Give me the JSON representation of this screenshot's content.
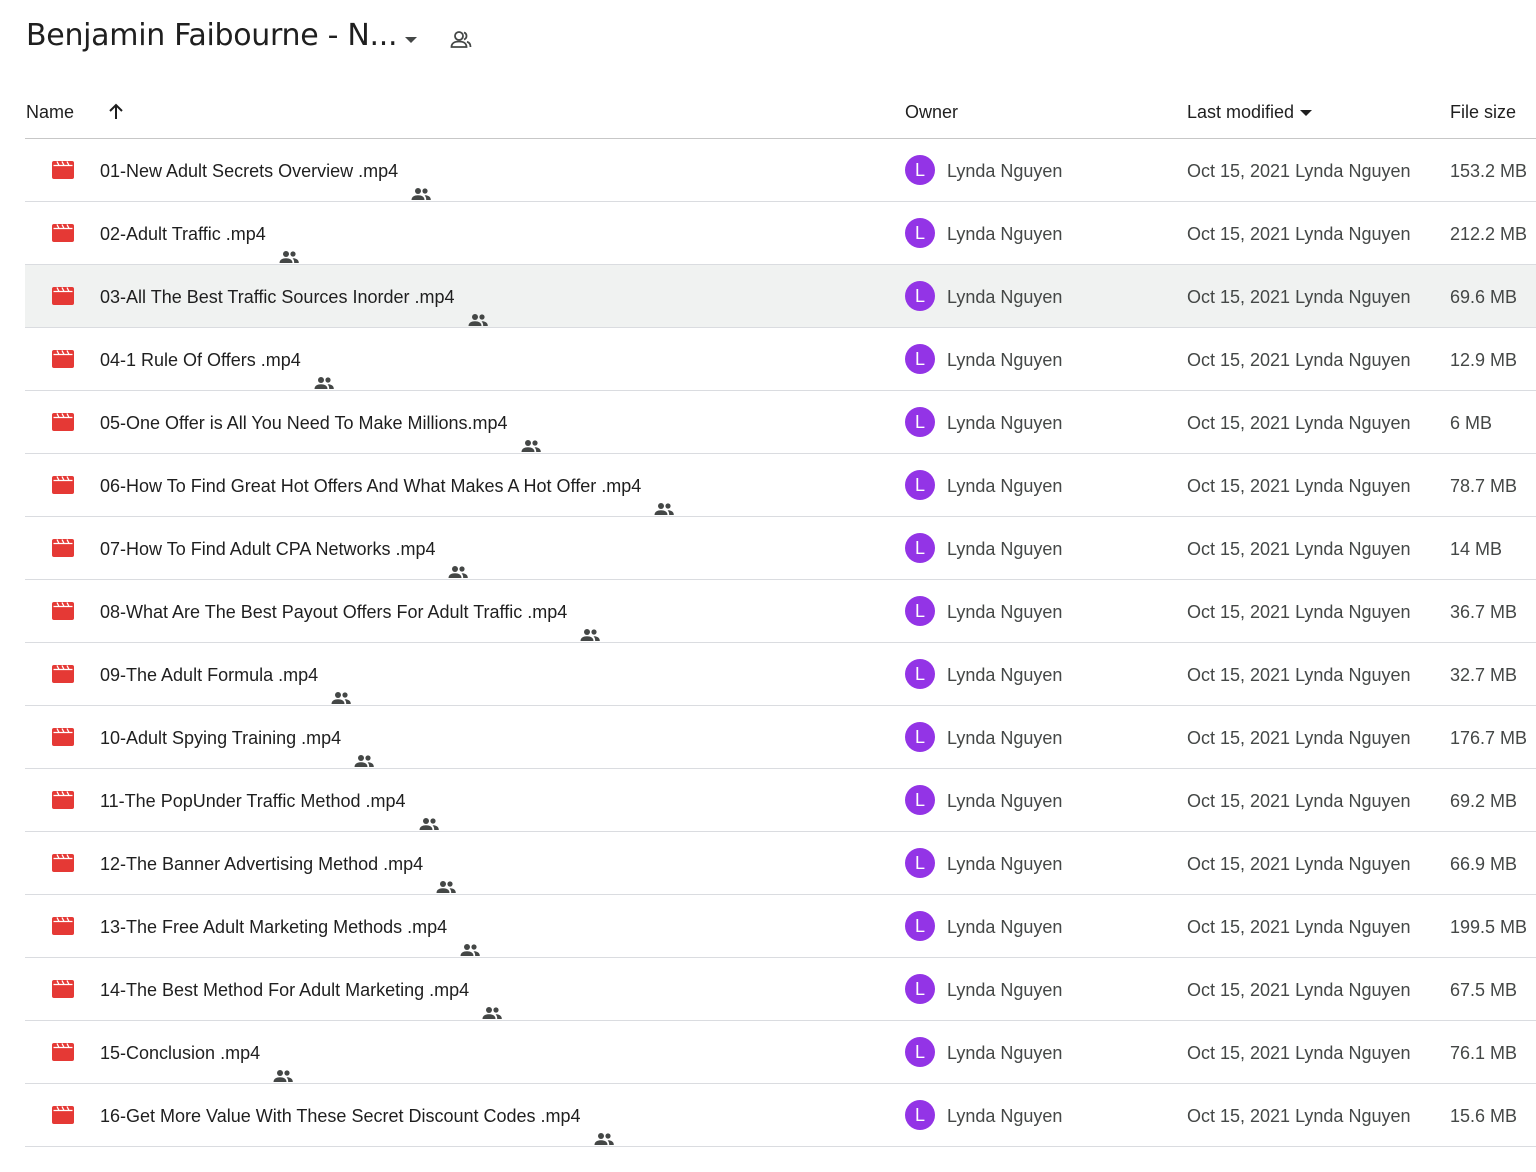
{
  "folder": {
    "title": "Benjamin Faibourne - N..."
  },
  "columns": {
    "name": "Name",
    "owner": "Owner",
    "last_modified": "Last modified",
    "file_size": "File size"
  },
  "icons": {
    "file": "video-file-icon",
    "shared": "shared-people-icon",
    "sort": "arrow-up-icon",
    "dropdown": "caret-down-icon",
    "folder_share": "person-outline-icon"
  },
  "colors": {
    "file_icon": "#e53935",
    "avatar": "#9334e6",
    "row_hover": "#f0f2f1"
  },
  "files": [
    {
      "name": "01-New Adult Secrets Overview .mp4",
      "owner": "Lynda Nguyen",
      "avatar": "L",
      "modified": "Oct 15, 2021 Lynda Nguyen",
      "size": "153.2 MB"
    },
    {
      "name": "02-Adult Traffic .mp4",
      "owner": "Lynda Nguyen",
      "avatar": "L",
      "modified": "Oct 15, 2021 Lynda Nguyen",
      "size": "212.2 MB"
    },
    {
      "name": "03-All The Best Traffic Sources Inorder .mp4",
      "owner": "Lynda Nguyen",
      "avatar": "L",
      "modified": "Oct 15, 2021 Lynda Nguyen",
      "size": "69.6 MB"
    },
    {
      "name": "04-1 Rule Of Offers .mp4",
      "owner": "Lynda Nguyen",
      "avatar": "L",
      "modified": "Oct 15, 2021 Lynda Nguyen",
      "size": "12.9 MB"
    },
    {
      "name": "05-One Offer is All You Need To Make Millions.mp4",
      "owner": "Lynda Nguyen",
      "avatar": "L",
      "modified": "Oct 15, 2021 Lynda Nguyen",
      "size": "6 MB"
    },
    {
      "name": "06-How To Find Great Hot Offers And What Makes A Hot Offer .mp4",
      "owner": "Lynda Nguyen",
      "avatar": "L",
      "modified": "Oct 15, 2021 Lynda Nguyen",
      "size": "78.7 MB"
    },
    {
      "name": "07-How To Find Adult CPA Networks .mp4",
      "owner": "Lynda Nguyen",
      "avatar": "L",
      "modified": "Oct 15, 2021 Lynda Nguyen",
      "size": "14 MB"
    },
    {
      "name": "08-What Are The Best Payout Offers For Adult Traffic .mp4",
      "owner": "Lynda Nguyen",
      "avatar": "L",
      "modified": "Oct 15, 2021 Lynda Nguyen",
      "size": "36.7 MB"
    },
    {
      "name": "09-The Adult Formula .mp4",
      "owner": "Lynda Nguyen",
      "avatar": "L",
      "modified": "Oct 15, 2021 Lynda Nguyen",
      "size": "32.7 MB"
    },
    {
      "name": "10-Adult Spying Training .mp4",
      "owner": "Lynda Nguyen",
      "avatar": "L",
      "modified": "Oct 15, 2021 Lynda Nguyen",
      "size": "176.7 MB"
    },
    {
      "name": "11-The PopUnder Traffic Method .mp4",
      "owner": "Lynda Nguyen",
      "avatar": "L",
      "modified": "Oct 15, 2021 Lynda Nguyen",
      "size": "69.2 MB"
    },
    {
      "name": "12-The Banner Advertising Method .mp4",
      "owner": "Lynda Nguyen",
      "avatar": "L",
      "modified": "Oct 15, 2021 Lynda Nguyen",
      "size": "66.9 MB"
    },
    {
      "name": "13-The Free Adult Marketing Methods .mp4",
      "owner": "Lynda Nguyen",
      "avatar": "L",
      "modified": "Oct 15, 2021 Lynda Nguyen",
      "size": "199.5 MB"
    },
    {
      "name": "14-The Best Method For Adult Marketing .mp4",
      "owner": "Lynda Nguyen",
      "avatar": "L",
      "modified": "Oct 15, 2021 Lynda Nguyen",
      "size": "67.5 MB"
    },
    {
      "name": "15-Conclusion .mp4",
      "owner": "Lynda Nguyen",
      "avatar": "L",
      "modified": "Oct 15, 2021 Lynda Nguyen",
      "size": "76.1 MB"
    },
    {
      "name": "16-Get More Value With These Secret Discount Codes .mp4",
      "owner": "Lynda Nguyen",
      "avatar": "L",
      "modified": "Oct 15, 2021 Lynda Nguyen",
      "size": "15.6 MB"
    }
  ],
  "hovered_row": 2
}
